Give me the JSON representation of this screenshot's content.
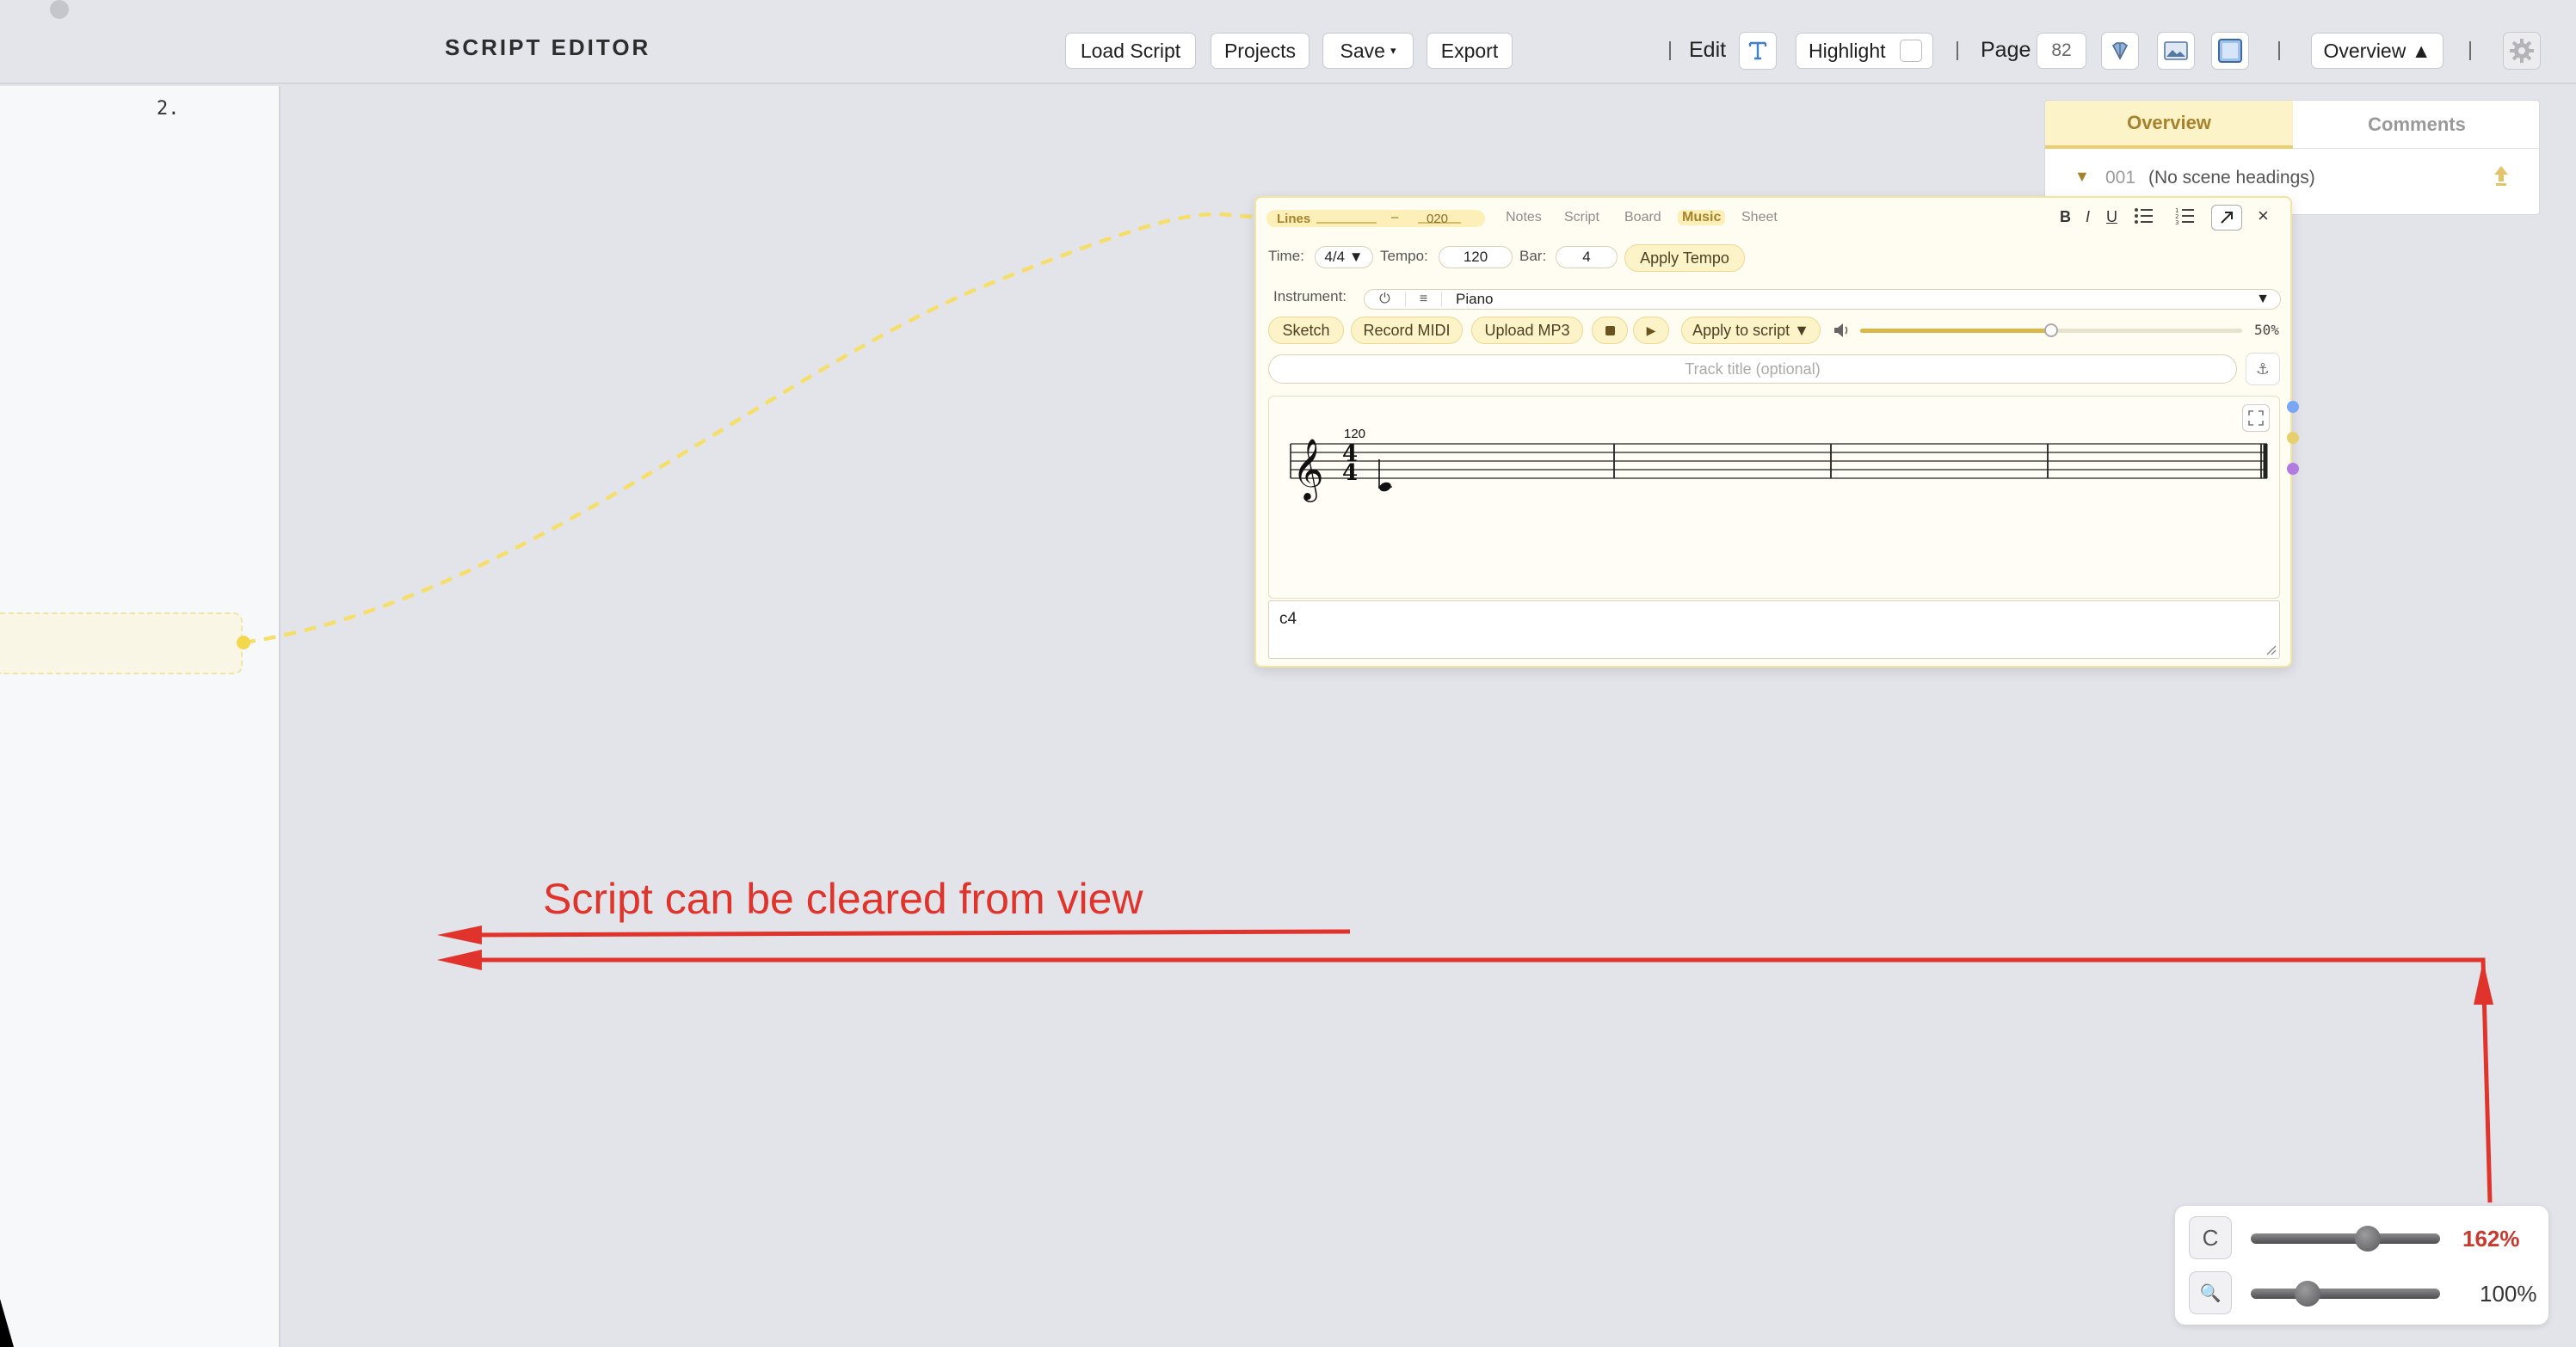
{
  "app": {
    "title": "SCRIPT EDITOR"
  },
  "toolbar": {
    "load_script": "Load Script",
    "projects": "Projects",
    "save": "Save",
    "export": "Export",
    "edit_label": "Edit",
    "highlight_label": "Highlight",
    "page_label": "Page",
    "page_number": "82",
    "overview_button": "Overview ▲"
  },
  "script": {
    "line_number": "2."
  },
  "overview_panel": {
    "tab_overview": "Overview",
    "tab_comments": "Comments",
    "scene_number": "001",
    "scene_label": "(No scene headings)"
  },
  "card": {
    "lines_label": "Lines",
    "lines_range_sep": "–",
    "lines_end": "020",
    "tabs": [
      "Notes",
      "Script",
      "Board",
      "Music",
      "Sheet"
    ],
    "active_tab": "Music",
    "format_buttons": [
      "B",
      "I",
      "U"
    ],
    "time_label": "Time:",
    "time_value": "4/4 ▼",
    "tempo_label": "Tempo:",
    "tempo_value": "120",
    "bar_label": "Bar:",
    "bar_value": "4",
    "apply_tempo": "Apply Tempo",
    "instrument_label": "Instrument:",
    "instrument_value": "Piano",
    "sketch": "Sketch",
    "record_midi": "Record MIDI",
    "upload_mp3": "Upload MP3",
    "apply_to_script": "Apply to script ▼",
    "volume": 0.5,
    "volume_label": "50%",
    "track_title_placeholder": "Track title (optional)",
    "score_tempo": "120",
    "time_signature_top": "4",
    "time_signature_bottom": "4",
    "notation_text": "c4",
    "side_dot_colors": [
      "#7aa7f3",
      "#e7cf6e",
      "#b27be0"
    ]
  },
  "annotation": {
    "text": "Script can be cleared from view",
    "color": "#e0332b"
  },
  "zoom": {
    "primary_value": 0.62,
    "primary_label": "162%",
    "secondary_value": 0.3,
    "secondary_label": "100%"
  },
  "colors": {
    "accent_yellow": "#f5de6a",
    "accent_red": "#e0332b",
    "blue_icon": "#3f7fd0"
  }
}
